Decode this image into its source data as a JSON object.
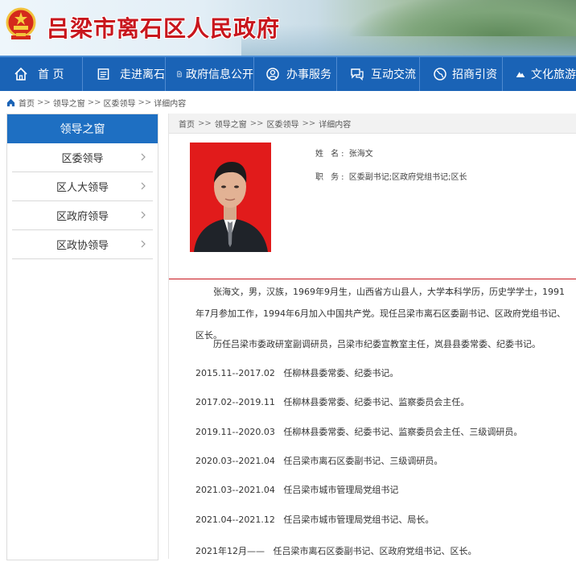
{
  "site": {
    "title": "吕梁市离石区人民政府"
  },
  "nav": [
    {
      "label": "首 页",
      "icon": "home-icon"
    },
    {
      "label": "走进离石",
      "icon": "book-icon"
    },
    {
      "label": "政府信息公开",
      "icon": "document-icon"
    },
    {
      "label": "办事服务",
      "icon": "person-icon"
    },
    {
      "label": "互动交流",
      "icon": "chat-icon"
    },
    {
      "label": "招商引资",
      "icon": "globe-icon"
    },
    {
      "label": "文化旅游",
      "icon": "mountain-icon"
    }
  ],
  "breadcrumb": {
    "items": [
      "首页",
      "领导之窗",
      "区委领导",
      "详细内容"
    ],
    "sep": ">>"
  },
  "sidebar": {
    "title": "领导之窗",
    "items": [
      "区委领导",
      "区人大领导",
      "区政府领导",
      "区政协领导"
    ]
  },
  "main": {
    "breadcrumb": [
      "首页",
      "领导之窗",
      "区委领导",
      "详细内容"
    ],
    "sep": ">>",
    "name_label": "姓 名:",
    "name": "张海文",
    "job_label": "职 务:",
    "job": "区委副书记;区政府党组书记;区长",
    "intro": "张海文，男，汉族，1969年9月生，山西省方山县人，大学本科学历，历史学学士，1991年7月参加工作，1994年6月加入中国共产党。现任吕梁市离石区委副书记、区政府党组书记、区长。",
    "history_intro": "历任吕梁市委政研室副调研员，吕梁市纪委宣教室主任，岚县县委常委、纪委书记。",
    "timeline": [
      "2015.11--2017.02   任柳林县委常委、纪委书记。",
      "2017.02--2019.11   任柳林县委常委、纪委书记、监察委员会主任。",
      "2019.11--2020.03   任柳林县委常委、纪委书记、监察委员会主任、三级调研员。",
      "2020.03--2021.04   任吕梁市离石区委副书记、三级调研员。",
      "2021.03--2021.04   任吕梁市城市管理局党组书记",
      "2021.04--2021.12   任吕梁市城市管理局党组书记、局长。",
      "2021年12月——   任吕梁市离石区委副书记、区政府党组书记、区长。"
    ]
  },
  "colors": {
    "nav_bg": "#1a63b6",
    "sidebar_head": "#1e6fc2",
    "title_red": "#c8161d",
    "divider_red": "#c8161d"
  }
}
